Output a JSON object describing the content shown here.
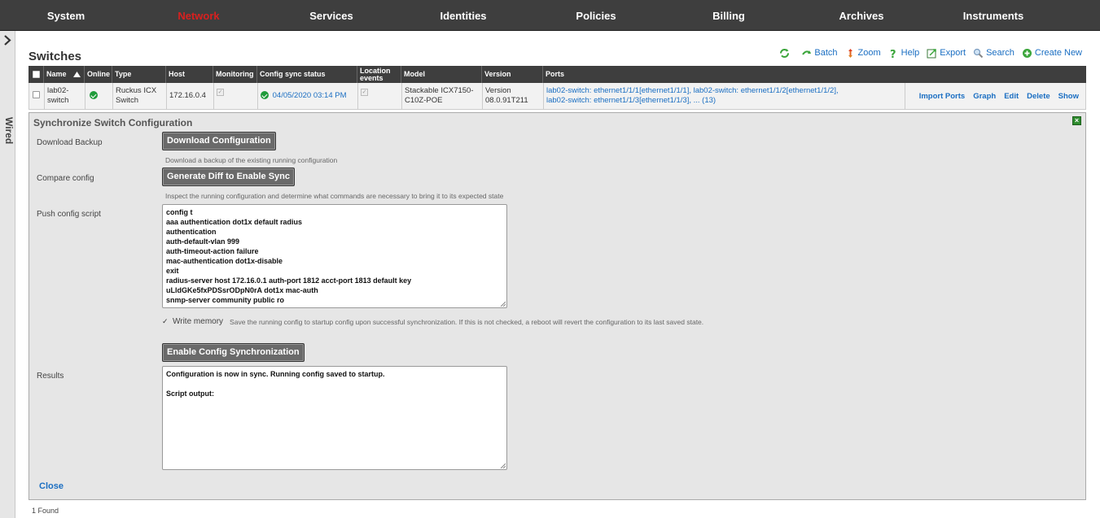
{
  "nav": {
    "items": [
      {
        "label": "System",
        "active": false
      },
      {
        "label": "Network",
        "active": true
      },
      {
        "label": "Services",
        "active": false
      },
      {
        "label": "Identities",
        "active": false
      },
      {
        "label": "Policies",
        "active": false
      },
      {
        "label": "Billing",
        "active": false
      },
      {
        "label": "Archives",
        "active": false
      },
      {
        "label": "Instruments",
        "active": false
      }
    ],
    "active_color": "#d9201f"
  },
  "side": {
    "tab_label": "Wired",
    "toggle_icon": "chevron-right-icon"
  },
  "page": {
    "title": "Switches"
  },
  "toolbar": {
    "refresh_icon": "refresh-icon",
    "items": [
      {
        "label": "Batch",
        "icon": "batch-icon"
      },
      {
        "label": "Zoom",
        "icon": "zoom-arrows-icon"
      },
      {
        "label": "Help",
        "icon": "help-icon"
      },
      {
        "label": "Export",
        "icon": "export-icon"
      },
      {
        "label": "Search",
        "icon": "search-icon"
      },
      {
        "label": "Create New",
        "icon": "plus-circle-icon"
      }
    ]
  },
  "table": {
    "headers": {
      "name": "Name",
      "online": "Online",
      "type": "Type",
      "host": "Host",
      "monitoring": "Monitoring",
      "config_sync": "Config sync status",
      "location": "Location events",
      "model": "Model",
      "version": "Version",
      "ports": "Ports"
    },
    "rows": [
      {
        "name": "lab02-switch",
        "type": "Ruckus ICX Switch",
        "host": "172.16.0.4",
        "sync_time": "04/05/2020 03:14 PM",
        "model": "Stackable ICX7150-C10Z-POE",
        "version": "Version 08.0.91T211",
        "ports_line1": "lab02-switch: ethernet1/1/1[ethernet1/1/1], lab02-switch: ethernet1/1/2[ethernet1/1/2],",
        "ports_line2": "lab02-switch: ethernet1/1/3[ethernet1/1/3], ... (13)",
        "actions": {
          "import_ports": "Import Ports",
          "graph": "Graph",
          "edit": "Edit",
          "delete": "Delete",
          "show": "Show"
        }
      }
    ]
  },
  "panel": {
    "title": "Synchronize Switch Configuration",
    "download": {
      "label": "Download Backup",
      "button": "Download Configuration",
      "help": "Download a backup of the existing running configuration"
    },
    "compare": {
      "label": "Compare config",
      "button": "Generate Diff to Enable Sync",
      "help": "Inspect the running configuration and determine what commands are necessary to bring it to its expected state"
    },
    "push": {
      "label": "Push config script",
      "lines": [
        "config t",
        "aaa authentication dot1x default radius",
        "authentication",
        "auth-default-vlan 999",
        "auth-timeout-action failure",
        "mac-authentication dot1x-disable",
        "exit",
        "radius-server host 172.16.0.1 auth-port 1812 acct-port 1813 default key",
        "uLldGKe5fxPDSsrODpN0rA dot1x mac-auth",
        "snmp-server community public ro"
      ]
    },
    "write_memory": {
      "checked": true,
      "label": "Write memory",
      "help": "Save the running config to startup config upon successful synchronization. If this is not checked, a reboot will revert the configuration to its last saved state."
    },
    "enable_button": "Enable Config Synchronization",
    "results": {
      "label": "Results",
      "line1": "Configuration is now in sync.  Running config saved to startup.",
      "line2": "Script output:"
    },
    "close": "Close"
  },
  "footer": {
    "found": "1 Found"
  }
}
